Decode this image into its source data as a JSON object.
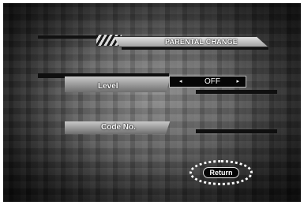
{
  "menu": {
    "title": "PARENTAL CHANGE"
  },
  "level": {
    "label": "Level",
    "value": "OFF",
    "left_arrow": "◂",
    "right_arrow": "▸"
  },
  "code": {
    "label": "Code No."
  },
  "return_button": {
    "label": "Return"
  }
}
